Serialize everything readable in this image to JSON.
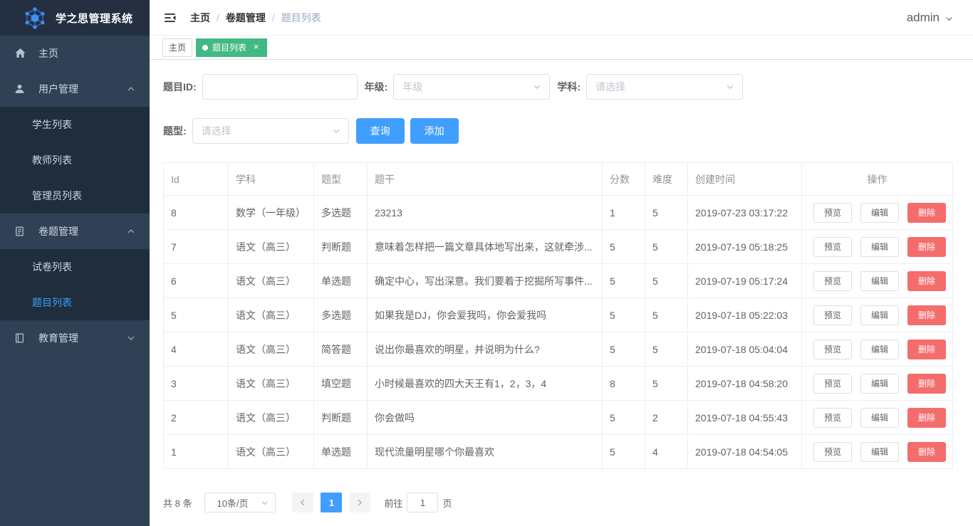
{
  "app": {
    "title": "学之思管理系统",
    "user": "admin"
  },
  "sidebar": {
    "active_item": "题目列表",
    "items": [
      {
        "label": "主页",
        "icon": "home-icon",
        "children": []
      },
      {
        "label": "用户管理",
        "icon": "user-icon",
        "arrow": "up",
        "children": [
          "学生列表",
          "教师列表",
          "管理员列表"
        ]
      },
      {
        "label": "卷题管理",
        "icon": "exam-icon",
        "arrow": "up",
        "children": [
          "试卷列表",
          "题目列表"
        ]
      },
      {
        "label": "教育管理",
        "icon": "education-icon",
        "arrow": "down",
        "children": []
      }
    ]
  },
  "breadcrumb": {
    "separator": "/",
    "items": [
      "主页",
      "卷题管理",
      "题目列表"
    ]
  },
  "tabs": [
    {
      "label": "主页",
      "active": false,
      "closable": false
    },
    {
      "label": "题目列表",
      "active": true,
      "closable": true
    }
  ],
  "filters": {
    "question_id": {
      "label": "题目ID:",
      "value": ""
    },
    "grade": {
      "label": "年级:",
      "placeholder": "年级"
    },
    "subject": {
      "label": "学科:",
      "placeholder": "请选择"
    },
    "question_type": {
      "label": "题型:",
      "placeholder": "请选择"
    },
    "search_button": "查询",
    "add_button": "添加"
  },
  "table": {
    "columns": [
      "Id",
      "学科",
      "题型",
      "题干",
      "分数",
      "难度",
      "创建时间",
      "操作"
    ],
    "actions": {
      "preview": "预览",
      "edit": "编辑",
      "delete": "删除"
    },
    "rows": [
      {
        "id": "8",
        "subject": "数学（一年级）",
        "type": "多选题",
        "stem": "23213",
        "score": "1",
        "difficulty": "5",
        "created": "2019-07-23 03:17:22"
      },
      {
        "id": "7",
        "subject": "语文（高三）",
        "type": "判断题",
        "stem": "意味着怎样把一篇文章具体地写出来，这就牵涉...",
        "score": "5",
        "difficulty": "5",
        "created": "2019-07-19 05:18:25"
      },
      {
        "id": "6",
        "subject": "语文（高三）",
        "type": "单选题",
        "stem": "确定中心，写出深意。我们要着于挖掘所写事件...",
        "score": "5",
        "difficulty": "5",
        "created": "2019-07-19 05:17:24"
      },
      {
        "id": "5",
        "subject": "语文（高三）",
        "type": "多选题",
        "stem": "如果我是DJ，你会爱我吗，你会爱我吗",
        "score": "5",
        "difficulty": "5",
        "created": "2019-07-18 05:22:03"
      },
      {
        "id": "4",
        "subject": "语文（高三）",
        "type": "简答题",
        "stem": "说出你最喜欢的明星，并说明为什么?",
        "score": "5",
        "difficulty": "5",
        "created": "2019-07-18 05:04:04"
      },
      {
        "id": "3",
        "subject": "语文（高三）",
        "type": "填空题",
        "stem": "小时候最喜欢的四大天王有1，2，3，4",
        "score": "8",
        "difficulty": "5",
        "created": "2019-07-18 04:58:20"
      },
      {
        "id": "2",
        "subject": "语文（高三）",
        "type": "判断题",
        "stem": "你会做吗",
        "score": "5",
        "difficulty": "2",
        "created": "2019-07-18 04:55:43"
      },
      {
        "id": "1",
        "subject": "语文（高三）",
        "type": "单选题",
        "stem": "现代流量明星哪个你最喜欢",
        "score": "5",
        "difficulty": "4",
        "created": "2019-07-18 04:54:05"
      }
    ]
  },
  "pagination": {
    "total": "共 8 条",
    "page_size": "10条/页",
    "current_page": "1",
    "goto_label": "前往",
    "goto_value": "1",
    "page_label": "页"
  },
  "colors": {
    "primary": "#409eff",
    "danger": "#f56c6c",
    "tab_active": "#42b983",
    "sidebar_bg": "#304156",
    "submenu_bg": "#1f2d3d",
    "logo_bg": "#242f42"
  }
}
